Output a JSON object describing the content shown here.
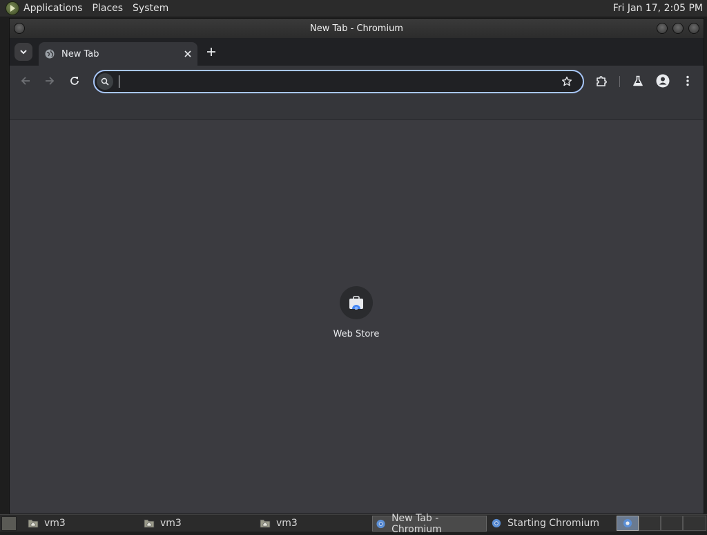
{
  "top_panel": {
    "menus": [
      "Applications",
      "Places",
      "System"
    ],
    "clock": "Fri Jan 17,  2:05 PM"
  },
  "window": {
    "title": "New Tab - Chromium"
  },
  "browser": {
    "tab_title": "New Tab",
    "omnibox_value": "",
    "shortcut_label": "Web Store"
  },
  "taskbar": {
    "tasks": [
      {
        "label": "vm3",
        "icon": "folder-icon"
      },
      {
        "label": "vm3",
        "icon": "folder-icon"
      },
      {
        "label": "vm3",
        "icon": "folder-icon"
      },
      {
        "label": "New Tab - Chromium",
        "icon": "chromium-icon",
        "active": true
      },
      {
        "label": "Starting Chromium",
        "icon": "chromium-icon"
      }
    ]
  },
  "colors": {
    "omnibox_focus": "#a8c7fa",
    "content_bg": "#3b3b40",
    "toolbar_bg": "#35363a"
  }
}
